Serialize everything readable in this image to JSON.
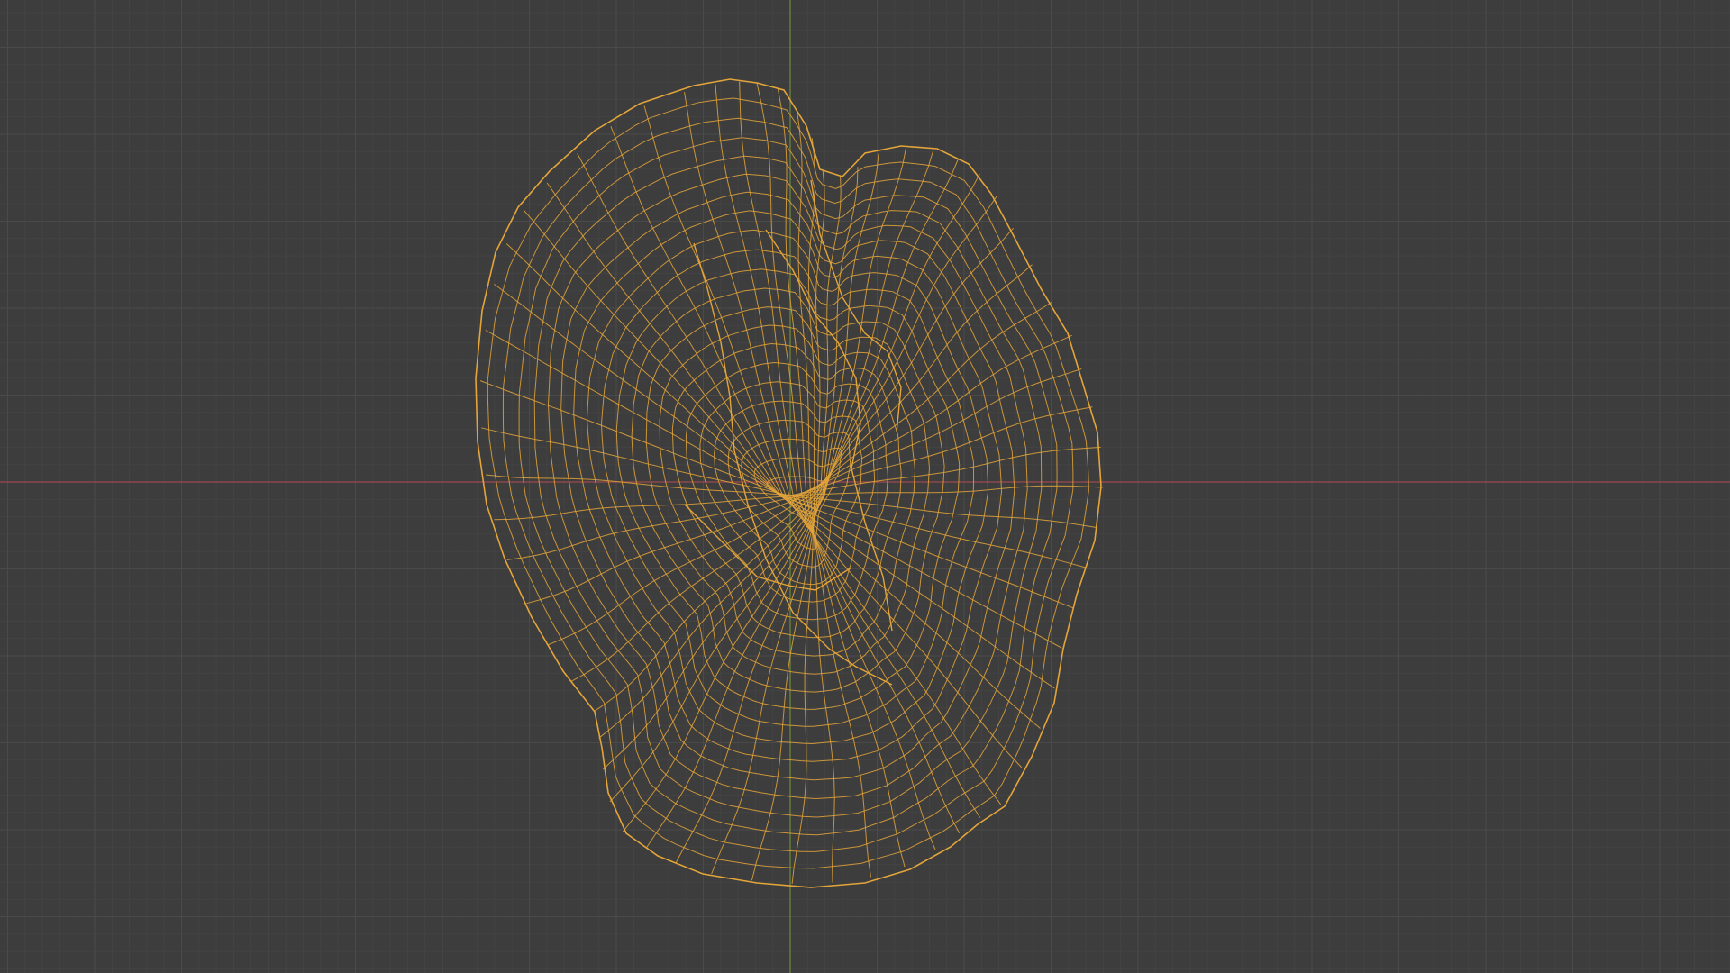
{
  "viewport": {
    "mode": "wireframe",
    "background_color": "#3d3d3d",
    "minor_grid_color": "#434343",
    "major_grid_color": "#4a4a4a",
    "x_axis_color": "#9b4a4f",
    "y_axis_color": "#6e8b3d",
    "wire_color": "#e3a53a",
    "object_shape": "organic-mesh"
  }
}
